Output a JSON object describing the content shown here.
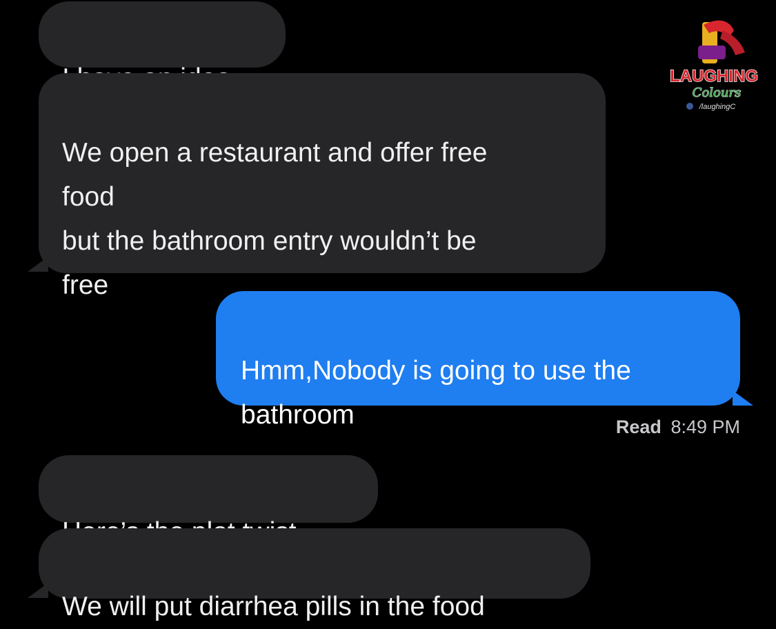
{
  "conversation": {
    "messages": [
      {
        "direction": "incoming",
        "text": "I have an idea"
      },
      {
        "direction": "incoming",
        "text": "We open a restaurant and offer  free\nfood\n but the bathroom entry wouldn’t be\nfree"
      },
      {
        "direction": "outgoing",
        "text": "Hmm,Nobody is going to use the\nbathroom"
      },
      {
        "direction": "incoming",
        "text": "Here’s the plot twist"
      },
      {
        "direction": "incoming",
        "text": "We will put diarrhea pills in the food"
      }
    ],
    "read_receipt": {
      "label": "Read",
      "time": "8:49 PM"
    }
  },
  "watermark": {
    "title": "LAUGHING",
    "subtitle": "Colours",
    "handle": "/laughingC"
  },
  "colors": {
    "background": "#000000",
    "incoming_bubble": "#262628",
    "outgoing_bubble": "#1f7ef0",
    "status_text": "#c7c7cc"
  }
}
